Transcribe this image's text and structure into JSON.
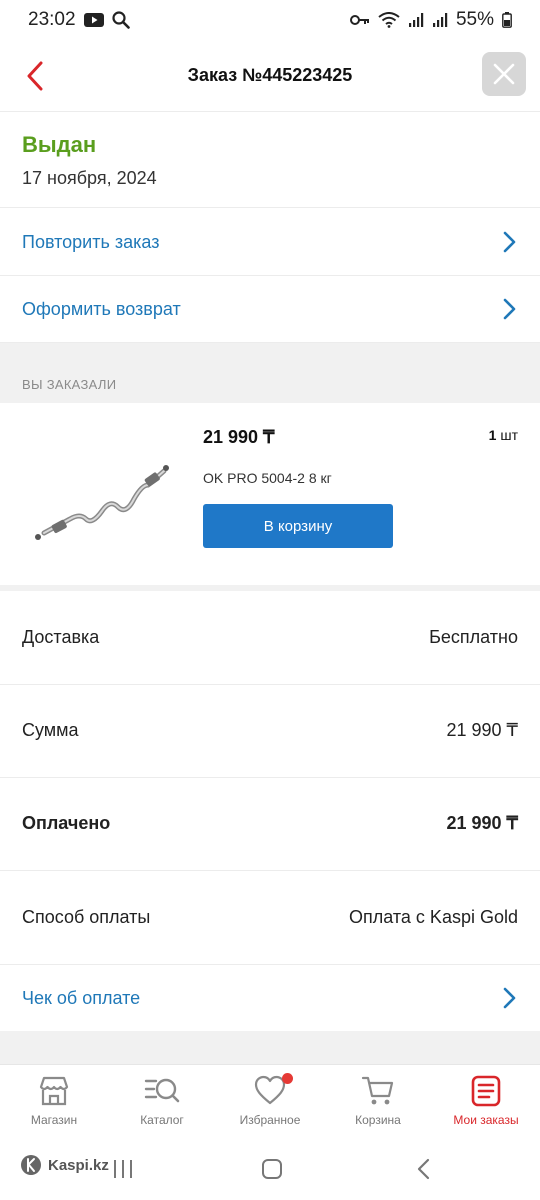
{
  "status_bar": {
    "time": "23:02",
    "battery": "55%"
  },
  "header": {
    "title": "Заказ №445223425"
  },
  "order_status": {
    "status": "Выдан",
    "date": "17 ноября, 2024"
  },
  "actions": {
    "repeat": "Повторить заказ",
    "return": "Оформить возврат"
  },
  "section": {
    "ordered_caption": "ВЫ ЗАКАЗАЛИ"
  },
  "product": {
    "price": "21 990 ₸",
    "qty_num": "1",
    "qty_unit": "шт",
    "name": "OK PRO 5004-2 8 кг",
    "cart_button": "В корзину"
  },
  "summary": {
    "delivery_label": "Доставка",
    "delivery_value": "Бесплатно",
    "sum_label": "Сумма",
    "sum_value": "21 990 ₸",
    "paid_label": "Оплачено",
    "paid_value": "21 990 ₸",
    "method_label": "Способ оплаты",
    "method_value": "Оплата с Kaspi Gold"
  },
  "receipt": {
    "label": "Чек об оплате"
  },
  "bottom_nav": {
    "shop": "Магазин",
    "catalog": "Каталог",
    "favorites": "Избранное",
    "cart": "Корзина",
    "orders": "Мои заказы"
  },
  "watermark": "Kaspi.kz",
  "colors": {
    "accent_red": "#d9262a",
    "link_blue": "#1f78b8",
    "status_green": "#5a9e1e",
    "button_blue": "#1f78c8"
  },
  "icons": [
    "back-arrow-icon",
    "close-icon",
    "chevron-right-icon",
    "store-icon",
    "catalog-search-icon",
    "heart-icon",
    "cart-icon",
    "orders-icon"
  ]
}
